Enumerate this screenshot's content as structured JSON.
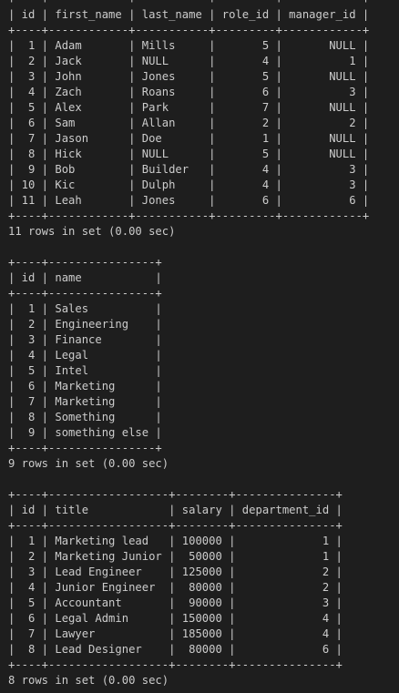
{
  "terminal": {
    "background_color": "#1e1e1e",
    "text_color": "#cccccc",
    "lines": [
      "+----+------------+-----------+---------+------------+",
      "| id | first_name | last_name | role_id | manager_id |",
      "+----+------------+-----------+---------+------------+",
      "|  1 | Adam       | Mills     |       5 |       NULL |",
      "|  2 | Jack       | NULL      |       4 |          1 |",
      "|  3 | John       | Jones     |       5 |       NULL |",
      "|  4 | Zach       | Roans     |       6 |          3 |",
      "|  5 | Alex       | Park      |       7 |       NULL |",
      "|  6 | Sam        | Allan     |       2 |          2 |",
      "|  7 | Jason      | Doe       |       1 |       NULL |",
      "|  8 | Hick       | NULL      |       5 |       NULL |",
      "|  9 | Bob        | Builder   |       4 |          3 |",
      "| 10 | Kic        | Dulph     |       4 |          3 |",
      "| 11 | Leah       | Jones     |       6 |          6 |",
      "+----+------------+-----------+---------+------------+",
      "11 rows in set (0.00 sec)",
      "",
      "+----+----------------+",
      "| id | name           |",
      "+----+----------------+",
      "|  1 | Sales          |",
      "|  2 | Engineering    |",
      "|  3 | Finance        |",
      "|  4 | Legal          |",
      "|  5 | Intel          |",
      "|  6 | Marketing      |",
      "|  7 | Marketing      |",
      "|  8 | Something      |",
      "|  9 | something else |",
      "+----+----------------+",
      "9 rows in set (0.00 sec)",
      "",
      "+----+------------------+--------+---------------+",
      "| id | title            | salary | department_id |",
      "+----+------------------+--------+---------------+",
      "|  1 | Marketing lead   | 100000 |             1 |",
      "|  2 | Marketing Junior |  50000 |             1 |",
      "|  3 | Lead Engineer    | 125000 |             2 |",
      "|  4 | Junior Engineer  |  80000 |             2 |",
      "|  5 | Accountant       |  90000 |             3 |",
      "|  6 | Legal Admin      | 150000 |             4 |",
      "|  7 | Lawyer           | 185000 |             4 |",
      "|  8 | Lead Designer    |  80000 |             6 |",
      "+----+------------------+--------+---------------+",
      "8 rows in set (0.00 sec)"
    ]
  }
}
